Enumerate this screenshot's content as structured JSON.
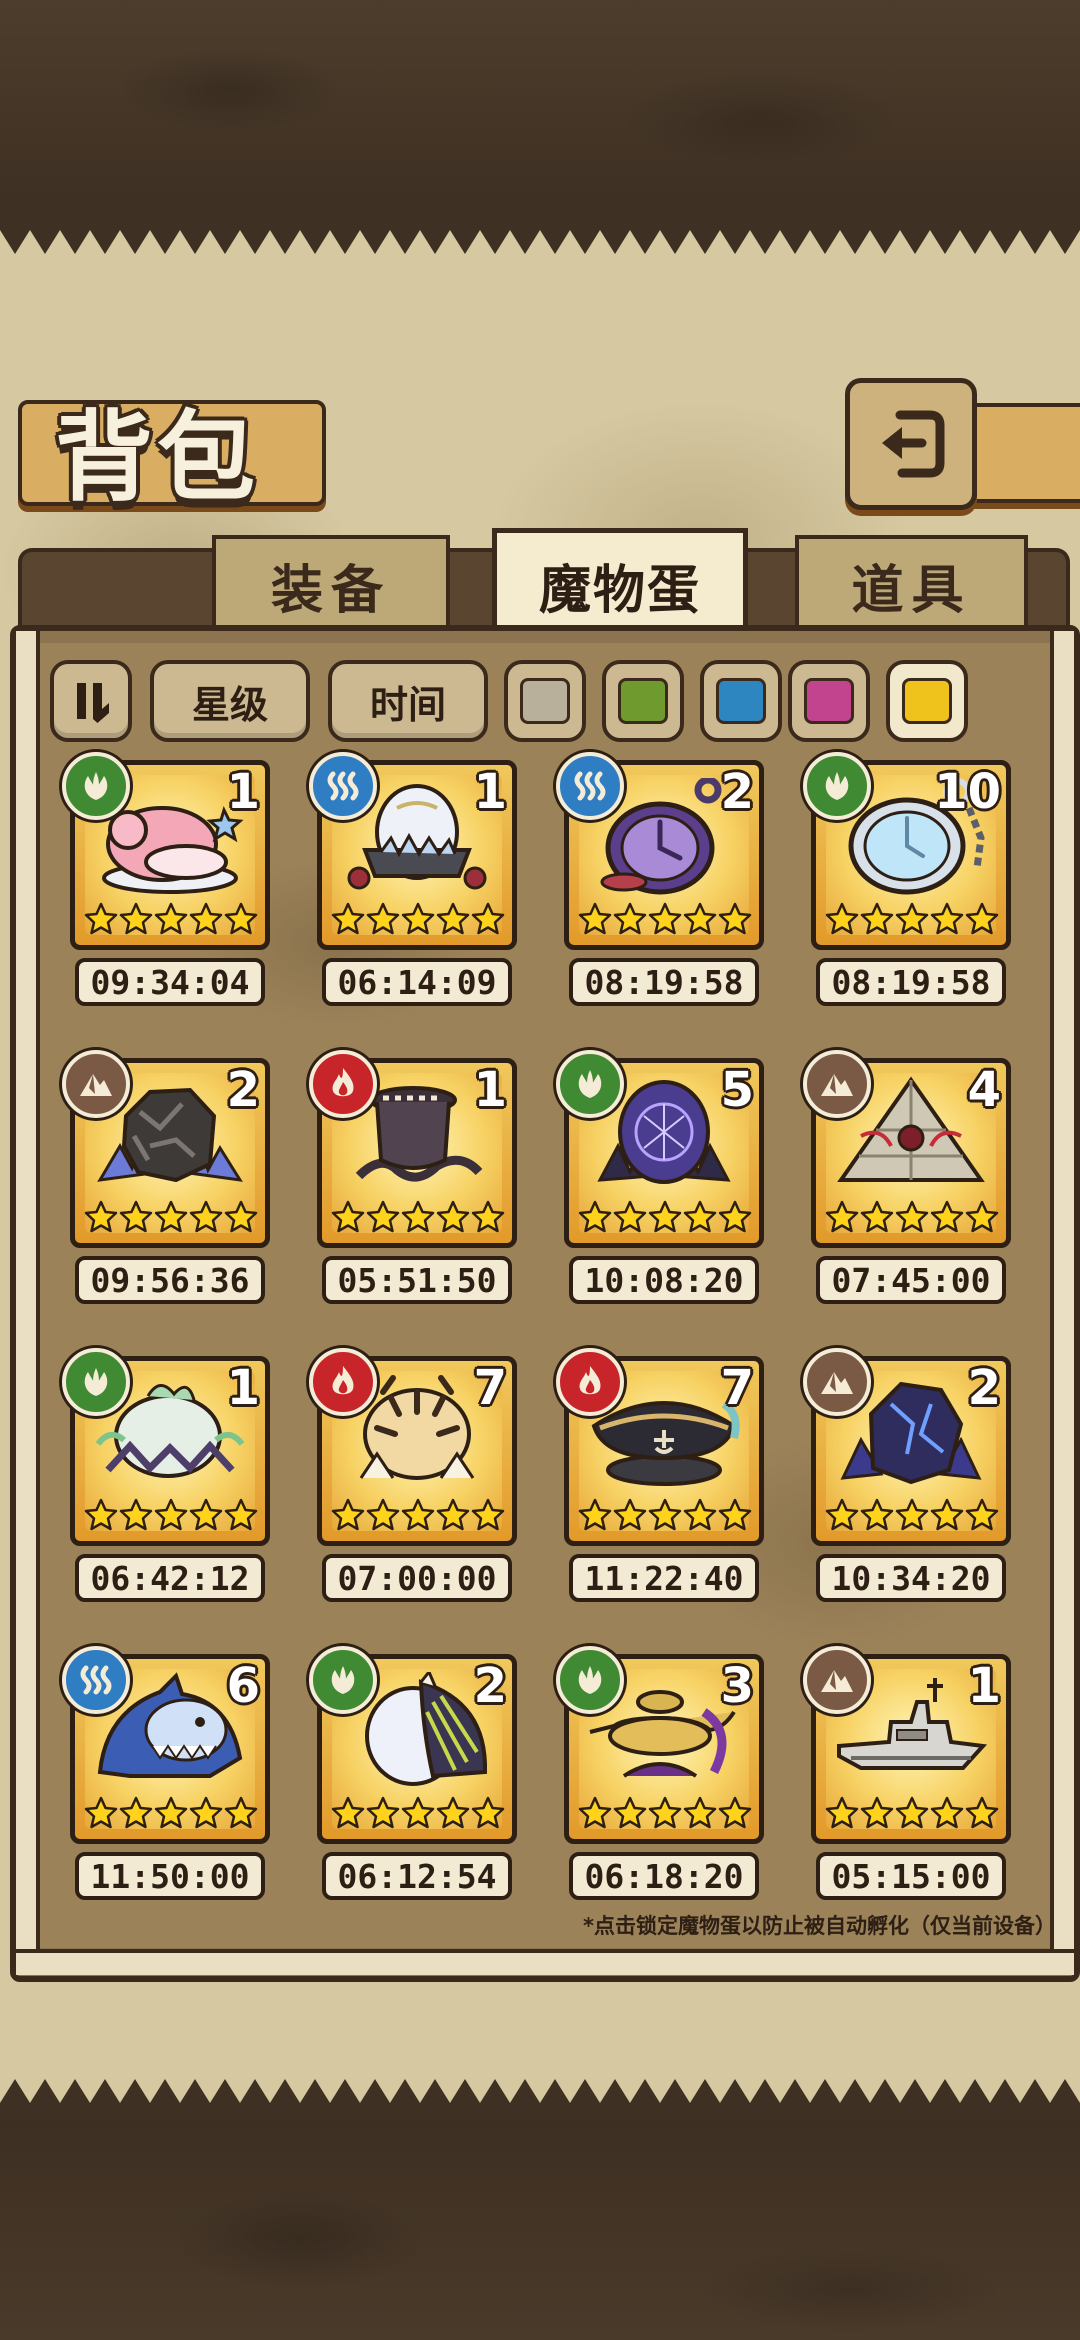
{
  "title": "背包",
  "tabs": [
    {
      "label": "装备",
      "active": false
    },
    {
      "label": "魔物蛋",
      "active": true
    },
    {
      "label": "道具",
      "active": false
    }
  ],
  "filters": {
    "sort_star": "星级",
    "sort_time": "时间",
    "rarity_colors": [
      "#b8b09a",
      "#6f9a2e",
      "#2e86c1",
      "#c2448f",
      "#f0c21c"
    ]
  },
  "elements": {
    "nature": {
      "color": "#3f8a32",
      "icon": "leaf-icon"
    },
    "water": {
      "color": "#2f7ec4",
      "icon": "wave-icon"
    },
    "fire": {
      "color": "#c8252b",
      "icon": "flame-icon"
    },
    "earth": {
      "color": "#7a5a44",
      "icon": "mountain-icon"
    }
  },
  "eggs": [
    {
      "element": "nature",
      "count": "1",
      "stars": 5,
      "time": "09:34:04",
      "art": "pink-cloud-egg"
    },
    {
      "element": "water",
      "count": "1",
      "stars": 5,
      "time": "06:14:09",
      "art": "crystal-egg"
    },
    {
      "element": "water",
      "count": "2",
      "stars": 5,
      "time": "08:19:58",
      "art": "purple-pocket-watch-egg"
    },
    {
      "element": "nature",
      "count": "10",
      "stars": 5,
      "time": "08:19:58",
      "art": "silver-pocket-watch-egg"
    },
    {
      "element": "earth",
      "count": "2",
      "stars": 5,
      "time": "09:56:36",
      "art": "rock-egg"
    },
    {
      "element": "fire",
      "count": "1",
      "stars": 5,
      "time": "05:51:50",
      "art": "dark-jar-egg"
    },
    {
      "element": "nature",
      "count": "5",
      "stars": 5,
      "time": "10:08:20",
      "art": "rune-egg"
    },
    {
      "element": "earth",
      "count": "4",
      "stars": 5,
      "time": "07:45:00",
      "art": "pyramid-egg"
    },
    {
      "element": "nature",
      "count": "1",
      "stars": 5,
      "time": "06:42:12",
      "art": "leaf-egg"
    },
    {
      "element": "fire",
      "count": "7",
      "stars": 5,
      "time": "07:00:00",
      "art": "tiger-egg"
    },
    {
      "element": "fire",
      "count": "7",
      "stars": 5,
      "time": "11:22:40",
      "art": "pirate-hat-egg"
    },
    {
      "element": "earth",
      "count": "2",
      "stars": 5,
      "time": "10:34:20",
      "art": "dark-crystal-egg"
    },
    {
      "element": "water",
      "count": "6",
      "stars": 5,
      "time": "11:50:00",
      "art": "shark-egg"
    },
    {
      "element": "nature",
      "count": "2",
      "stars": 5,
      "time": "06:12:54",
      "art": "wing-egg"
    },
    {
      "element": "nature",
      "count": "3",
      "stars": 5,
      "time": "06:18:20",
      "art": "magic-lamp-egg"
    },
    {
      "element": "earth",
      "count": "1",
      "stars": 5,
      "time": "05:15:00",
      "art": "battleship-egg"
    }
  ],
  "note": "*点击锁定魔物蛋以防止被自动孵化（仅当前设备）"
}
